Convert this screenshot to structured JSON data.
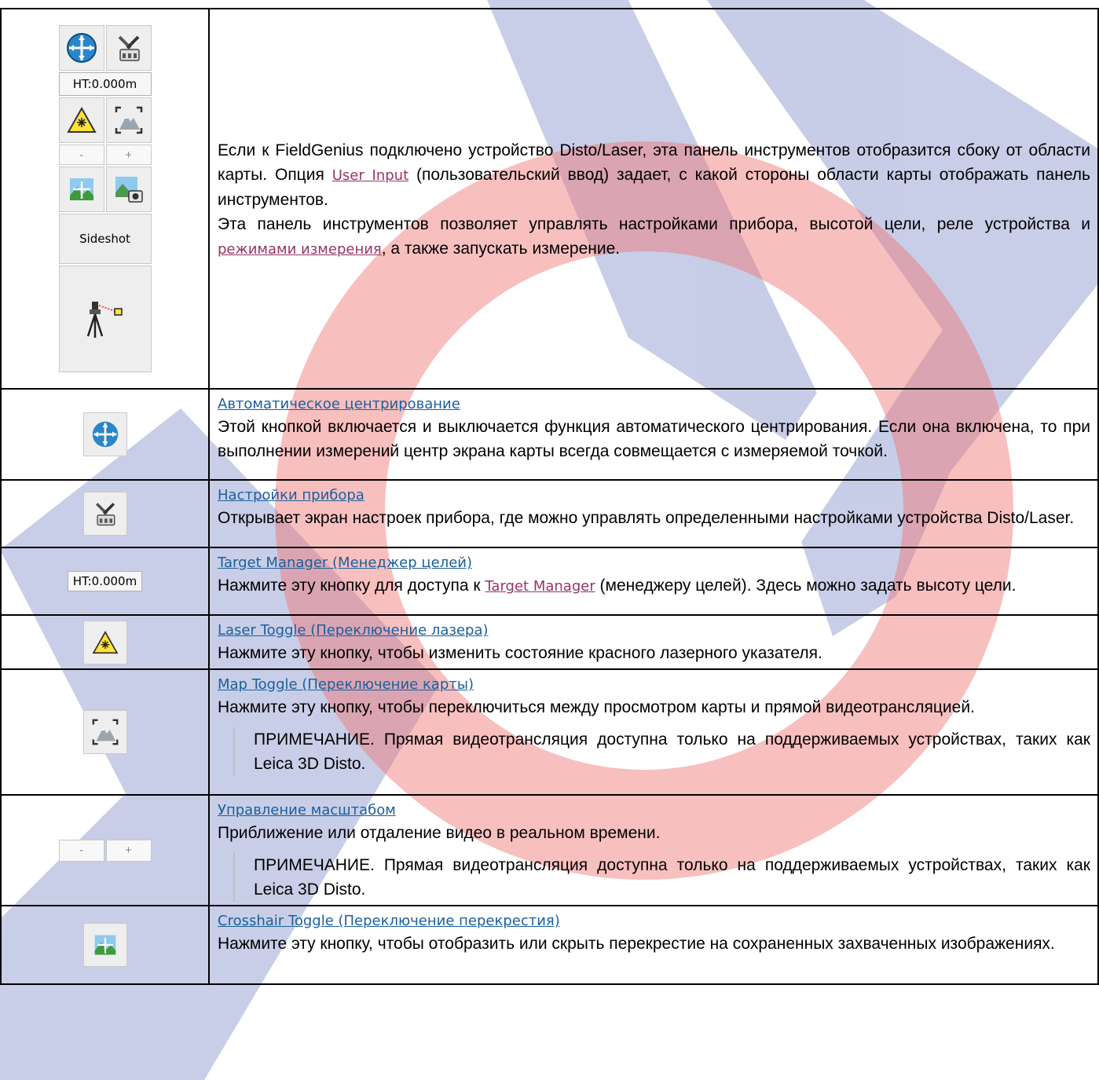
{
  "toolbar": {
    "ht_label": "HT:0.000m",
    "zoom_minus": "-",
    "zoom_plus": "+",
    "sideshot_label": "Sideshot"
  },
  "intro": {
    "p1_before": "Если к FieldGenius подключено устройство Disto/Laser, эта панель инструментов отобразится сбоку от области карты. Опция ",
    "p1_link": "User Input",
    "p1_after": " (пользовательский ввод) задает, с какой стороны области карты отображать панель инструментов.",
    "p2_before": "Эта панель инструментов позволяет управлять настройками прибора, высотой цели, реле устройства и ",
    "p2_link": "режимами измерения",
    "p2_after": ", а также запускать измерение."
  },
  "rows": [
    {
      "title": "Автоматическое центрирование",
      "text": "Этой кнопкой включается и выключается функция автоматического центрирования. Если она включена, то при выполнении измерений центр экрана карты всегда совмещается с измеряемой точкой."
    },
    {
      "title": "Настройки прибора",
      "text": "Открывает экран настроек прибора, где можно управлять определенными настройками устройства Disto/Laser."
    },
    {
      "title": "Target Manager (Менеджер целей)",
      "text_before": "Нажмите эту кнопку для доступа к ",
      "text_link": "Target Manager",
      "text_after": " (менеджеру целей). Здесь можно задать высоту цели."
    },
    {
      "title": "Laser Toggle (Переключение лазера)",
      "text": "Нажмите эту кнопку, чтобы изменить состояние красного лазерного указателя."
    },
    {
      "title": "Map Toggle (Переключение карты)",
      "text": "Нажмите эту кнопку, чтобы переключиться между просмотром карты и прямой видеотрансляцией.",
      "note": "ПРИМЕЧАНИЕ. Прямая видеотрансляция доступна только на поддерживаемых устройствах, таких как Leica 3D Disto."
    },
    {
      "title": "Управление масштабом",
      "text": "Приближение или отдаление видео в реальном времени.",
      "note": "ПРИМЕЧАНИЕ. Прямая видеотрансляция доступна только на поддерживаемых устройствах, таких как Leica 3D Disto."
    },
    {
      "title": "Crosshair Toggle (Переключение перекрестия)",
      "text": "Нажмите эту кнопку, чтобы отобразить или скрыть перекрестие на сохраненных захваченных изображениях."
    }
  ],
  "colors": {
    "link_title": "#1a5f9b",
    "link_inline": "#993366",
    "watermark_red": "#f07070",
    "watermark_blue": "#3a4fa8"
  }
}
